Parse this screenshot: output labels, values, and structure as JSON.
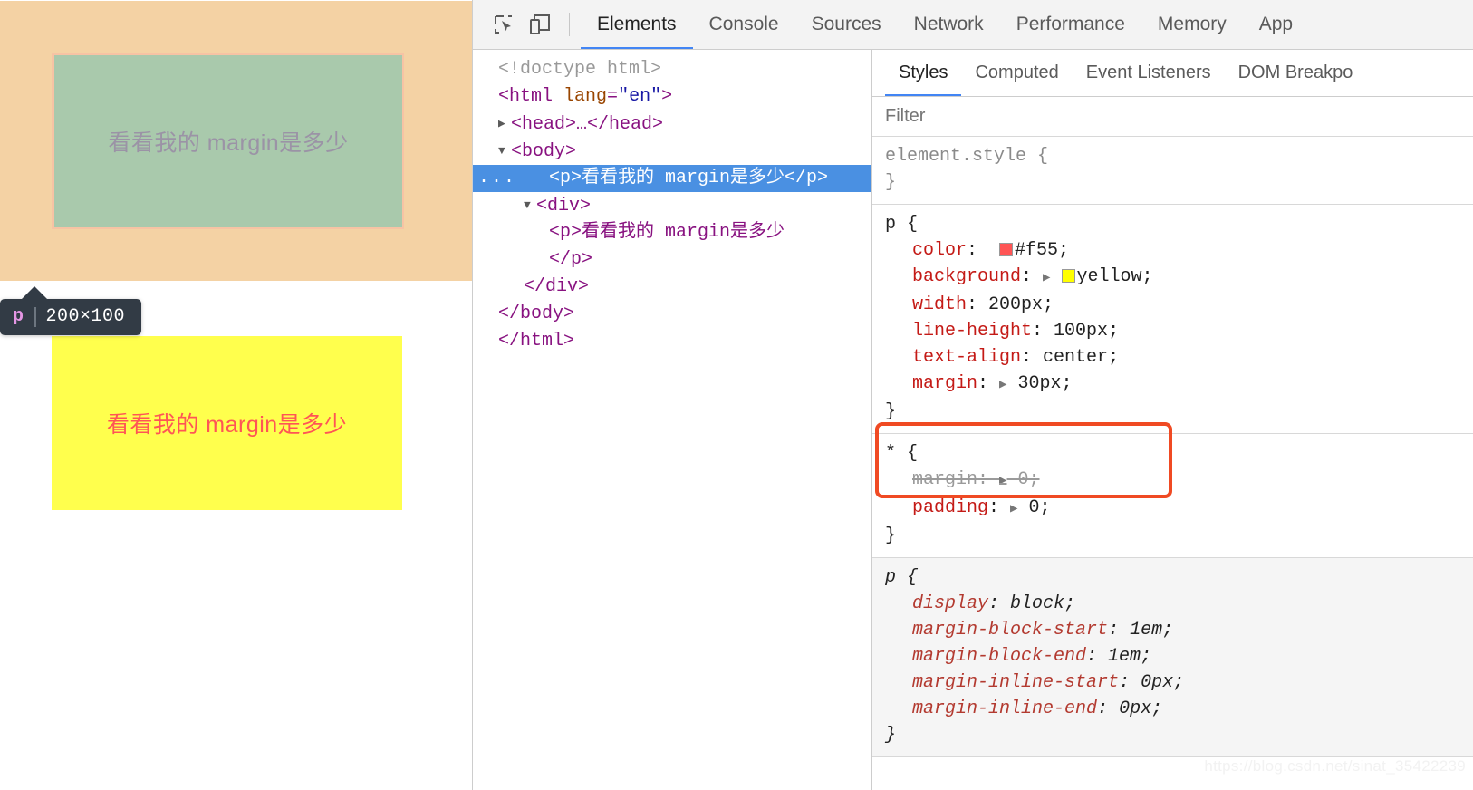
{
  "viewport": {
    "highlighted_element": {
      "overlay_text": "看看我的 margin是多少",
      "tooltip_tag": "p",
      "tooltip_dimensions": "200×100",
      "margin_color": "#f4d2a4",
      "padding_color": "#f6c3a4",
      "content_color": "#a9c9ac"
    },
    "paragraph": {
      "text": "看看我的 margin是多少",
      "background": "#ffff4d",
      "color": "#ff5555"
    }
  },
  "devtools": {
    "toolbar": {
      "inspect_icon": "inspect-element-icon",
      "device_icon": "device-toolbar-icon",
      "tabs": [
        {
          "label": "Elements",
          "active": true
        },
        {
          "label": "Console",
          "active": false
        },
        {
          "label": "Sources",
          "active": false
        },
        {
          "label": "Network",
          "active": false
        },
        {
          "label": "Performance",
          "active": false
        },
        {
          "label": "Memory",
          "active": false
        },
        {
          "label": "App",
          "active": false
        }
      ]
    },
    "dom_tree": {
      "doctype": "<!doctype html>",
      "html_open_tag": "<html",
      "html_attr_name": "lang",
      "html_attr_value": "\"en\"",
      "html_close_bracket": ">",
      "head_line": "<head>…</head>",
      "body_open": "<body>",
      "selected_line": "<p>看看我的 margin是多少</p>",
      "selected_badge": "...",
      "div_open": "<div>",
      "inner_p_open": "<p>看看我的 margin是多少",
      "inner_p_close": "</p>",
      "div_close": "</div>",
      "body_close": "</body>",
      "html_close": "</html>"
    },
    "styles": {
      "tabs": [
        {
          "label": "Styles",
          "active": true
        },
        {
          "label": "Computed",
          "active": false
        },
        {
          "label": "Event Listeners",
          "active": false
        },
        {
          "label": "DOM Breakpo",
          "active": false
        }
      ],
      "filter_placeholder": "Filter",
      "filter_value": "",
      "rules": [
        {
          "selector": "element.style",
          "open": "{",
          "close": "}",
          "declarations": []
        },
        {
          "selector": "p",
          "open": "{",
          "close": "}",
          "declarations": [
            {
              "prop": "color",
              "value": "#f55",
              "swatch": "#ff5555",
              "expandable": false
            },
            {
              "prop": "background",
              "value": "yellow",
              "swatch": "#ffff00",
              "expandable": true
            },
            {
              "prop": "width",
              "value": "200px",
              "expandable": false
            },
            {
              "prop": "line-height",
              "value": "100px",
              "expandable": false
            },
            {
              "prop": "text-align",
              "value": "center",
              "expandable": false
            },
            {
              "prop": "margin",
              "value": "30px",
              "expandable": true,
              "highlighted": true
            }
          ]
        },
        {
          "selector": "*",
          "open": "{",
          "close": "}",
          "declarations": [
            {
              "prop": "margin",
              "value": "0",
              "expandable": true,
              "struck": true
            },
            {
              "prop": "padding",
              "value": "0",
              "expandable": true
            }
          ]
        },
        {
          "selector": "p",
          "open": "{",
          "close": "}",
          "user_agent": true,
          "declarations": [
            {
              "prop": "display",
              "value": "block"
            },
            {
              "prop": "margin-block-start",
              "value": "1em"
            },
            {
              "prop": "margin-block-end",
              "value": "1em"
            },
            {
              "prop": "margin-inline-start",
              "value": "0px"
            },
            {
              "prop": "margin-inline-end",
              "value": "0px"
            }
          ]
        }
      ],
      "annotation_color": "#f04a23"
    }
  },
  "watermark": "https://blog.csdn.net/sinat_35422239"
}
